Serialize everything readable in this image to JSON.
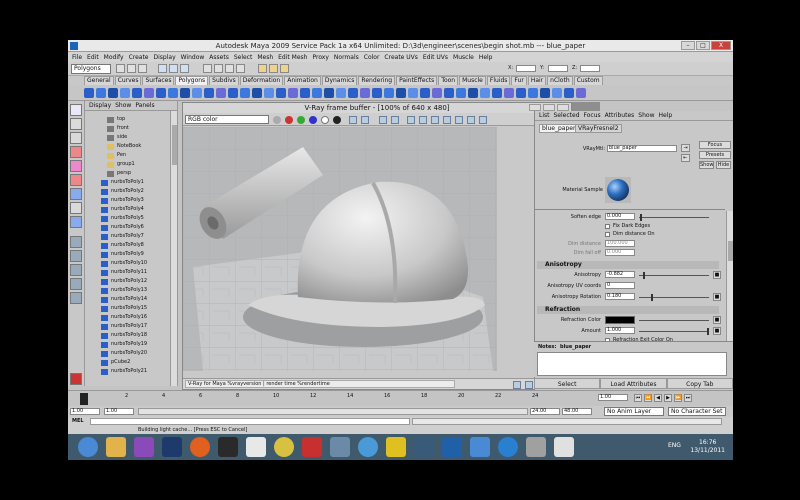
{
  "window": {
    "title": "Autodesk Maya 2009 Service Pack 1a x64 Unlimited: D:\\3d\\engineer\\scenes\\begin shot.mb  ---  blue_paper",
    "buttons": {
      "minimize": "–",
      "maximize": "□",
      "close": "X"
    }
  },
  "menubar": [
    "File",
    "Edit",
    "Modify",
    "Create",
    "Display",
    "Window",
    "Assets",
    "Select",
    "Mesh",
    "Edit Mesh",
    "Proxy",
    "Normals",
    "Color",
    "Create UVs",
    "Edit UVs",
    "Muscle",
    "Help"
  ],
  "statusline": {
    "mode": "Polygons",
    "x_label": "X:",
    "y_label": "Y:",
    "z_label": "Z:"
  },
  "shelf_tabs": [
    "General",
    "Curves",
    "Surfaces",
    "Polygons",
    "Subdivs",
    "Deformation",
    "Animation",
    "Dynamics",
    "Rendering",
    "PaintEffects",
    "Toon",
    "Muscle",
    "Fluids",
    "Fur",
    "Hair",
    "nCloth",
    "Custom"
  ],
  "shelf_active": "Polygons",
  "outliner": {
    "menu": [
      "Display",
      "Show",
      "Panels"
    ],
    "items": [
      "top",
      "front",
      "side",
      "NoteBook",
      "Pen",
      "group1",
      "persp",
      "nurbsToPoly1",
      "nurbsToPoly2",
      "nurbsToPoly3",
      "nurbsToPoly4",
      "nurbsToPoly5",
      "nurbsToPoly6",
      "nurbsToPoly7",
      "nurbsToPoly8",
      "nurbsToPoly9",
      "nurbsToPoly10",
      "nurbsToPoly11",
      "nurbsToPoly12",
      "nurbsToPoly13",
      "nurbsToPoly14",
      "nurbsToPoly15",
      "nurbsToPoly16",
      "nurbsToPoly17",
      "nurbsToPoly18",
      "nurbsToPoly19",
      "nurbsToPoly20",
      "pCube2",
      "nurbsToPoly21"
    ]
  },
  "vray": {
    "title": "V-Ray frame buffer - [100% of 640 x 480]",
    "channel": "RGB color",
    "status": "V-Ray for Maya %vrayversion | render time %rendertime"
  },
  "attribute_editor": {
    "menu": [
      "List",
      "Selected",
      "Focus",
      "Attributes",
      "Show",
      "Help"
    ],
    "tabs": [
      "blue_paper",
      "VRayFresnel2"
    ],
    "vraymtl_label": "VRayMtl:",
    "vraymtl_value": "blue_paper",
    "focus_btn": "Focus",
    "presets_btn": "Presets",
    "show_btn": "Show",
    "hide_btn": "Hide",
    "material_sample": "Material Sample",
    "soften_edge_label": "Soften edge",
    "soften_edge_value": "0.000",
    "fix_dark_edges": "Fix Dark Edges",
    "dim_distance_on": "Dim distance On",
    "dim_distance_label": "Dim distance",
    "dim_distance_value": "100.000",
    "dim_falloff_label": "Dim fall off",
    "dim_falloff_value": "0.000",
    "anisotropy_section": "Anisotropy",
    "anisotropy_label": "Anisotropy",
    "anisotropy_value": "-0.882",
    "aniso_uv_label": "Anisotropy UV coords",
    "aniso_uv_value": "0",
    "aniso_rot_label": "Anisotropy Rotation",
    "aniso_rot_value": "0.180",
    "refraction_section": "Refraction",
    "refraction_color_label": "Refraction Color",
    "amount_label": "Amount",
    "amount_value": "1.000",
    "refraction_exit_color": "Refraction Exit Color On",
    "notes_label": "Notes:",
    "notes_value": "blue_paper",
    "select_btn": "Select",
    "load_attrs_btn": "Load Attributes",
    "copy_tab_btn": "Copy Tab"
  },
  "timeline": {
    "ticks": [
      "2",
      "4",
      "6",
      "8",
      "10",
      "12",
      "14",
      "16",
      "18",
      "20",
      "22",
      "24"
    ],
    "current_frame": "1.00"
  },
  "range": {
    "start": "1.00",
    "start2": "1.00",
    "end": "24.00",
    "end2": "48.00",
    "anim_layer": "No Anim Layer",
    "character_set": "No Character Set"
  },
  "cmdline": {
    "label": "MEL"
  },
  "helpline": {
    "text": "Building light cache... [Press ESC to Cancel]"
  },
  "taskbar": {
    "time": "16:76",
    "date": "13/11/2011",
    "lang": "ENG"
  },
  "colors": {
    "maya_bg": "#c4c4c4",
    "taskbar": "#3f5a6d",
    "shelf_blue": "#2a5fc9",
    "material_sphere": "#2e6fbf"
  }
}
